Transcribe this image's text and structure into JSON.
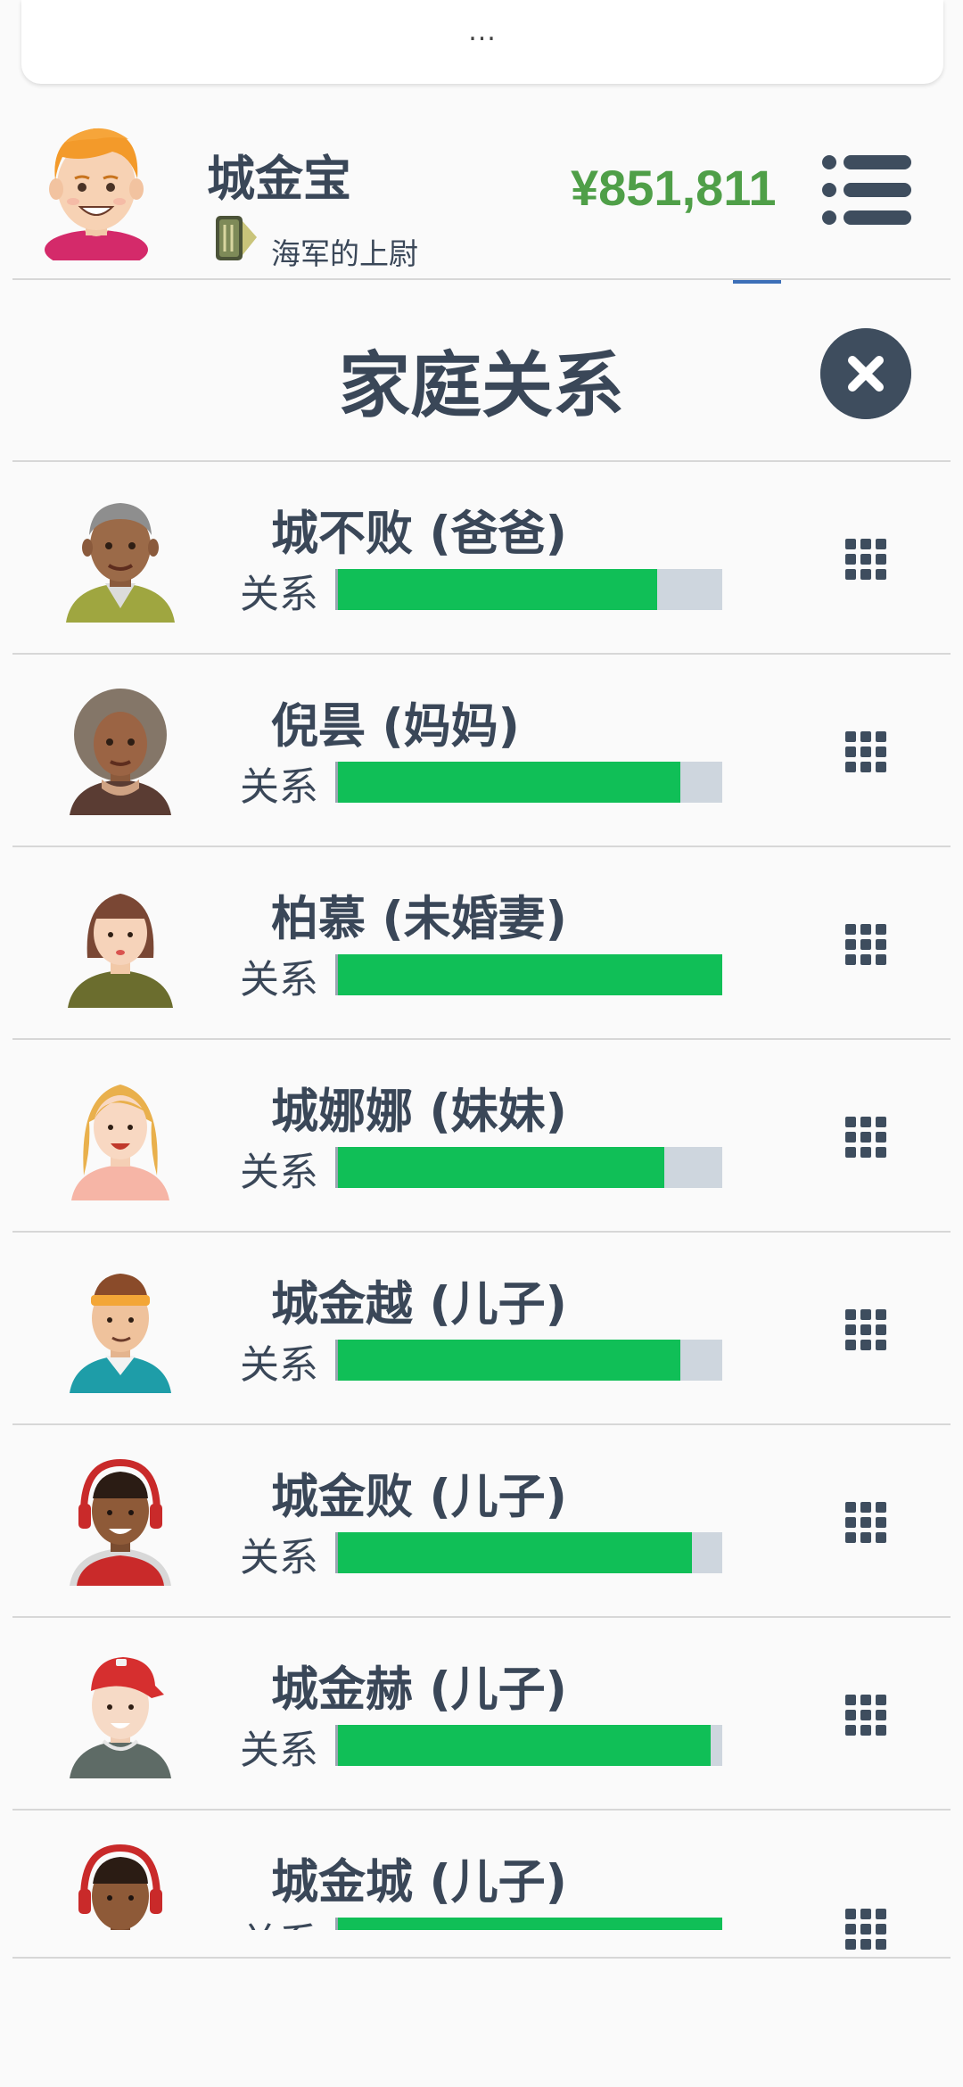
{
  "topbar": {
    "dots": "..."
  },
  "player": {
    "name": "城金宝",
    "rank": "海军的上尉",
    "money": "¥851,811"
  },
  "dialog": {
    "title": "家庭关系"
  },
  "relation_label": "关系",
  "family": [
    {
      "name": "城不败 (爸爸)",
      "relation": 0.83,
      "avatar": "elderly-man-avatar-icon"
    },
    {
      "name": "倪昙 (妈妈)",
      "relation": 0.89,
      "avatar": "elderly-woman-avatar-icon"
    },
    {
      "name": "柏慕 (未婚妻)",
      "relation": 1.0,
      "avatar": "young-woman-avatar-icon"
    },
    {
      "name": "城娜娜 (妹妹)",
      "relation": 0.85,
      "avatar": "blonde-girl-avatar-icon"
    },
    {
      "name": "城金越 (儿子)",
      "relation": 0.89,
      "avatar": "headband-boy-avatar-icon"
    },
    {
      "name": "城金败 (儿子)",
      "relation": 0.92,
      "avatar": "headphones-boy-avatar-icon"
    },
    {
      "name": "城金赫 (儿子)",
      "relation": 0.97,
      "avatar": "red-cap-boy-avatar-icon"
    },
    {
      "name": "城金城 (儿子)",
      "relation": 1.0,
      "avatar": "headphones-boy-avatar-icon"
    }
  ],
  "colors": {
    "bar_fill": "#10bf57",
    "bar_track": "#ced6de",
    "money": "#4f9f48",
    "text": "#3a4758"
  }
}
